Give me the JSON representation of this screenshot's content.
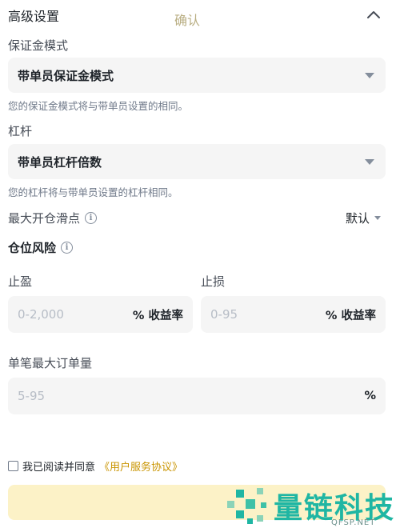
{
  "section": {
    "title": "高级设置",
    "collapse_icon": "chevron-up-icon"
  },
  "margin_mode": {
    "label": "保证金模式",
    "value": "带单员保证金模式",
    "hint": "您的保证金模式将与带单员设置的相同。"
  },
  "leverage": {
    "label": "杠杆",
    "value": "带单员杠杆倍数",
    "hint": "您的杠杆将与带单员设置的杠杆相同。"
  },
  "slippage": {
    "label": "最大开仓滑点",
    "value": "默认",
    "info_icon": "info-icon"
  },
  "position_risk": {
    "label": "仓位风险",
    "info_icon": "info-icon"
  },
  "take_profit": {
    "label": "止盈",
    "placeholder": "0-2,000",
    "suffix": "% 收益率"
  },
  "stop_loss": {
    "label": "止损",
    "placeholder": "0-95",
    "suffix": "% 收益率"
  },
  "max_order": {
    "label": "单笔最大订单量",
    "placeholder": "5-95",
    "suffix": "%"
  },
  "agreement": {
    "text": "我已阅读并同意",
    "link": "《用户服务协议》",
    "checked": false
  },
  "confirm": {
    "label": "确认"
  },
  "watermark": {
    "text": "量链科技",
    "url": "QFSP.NET"
  },
  "colors": {
    "accent": "#c99400",
    "confirm_bg": "#fcf2c7",
    "field_bg": "#f5f5f5",
    "watermark": "#1fb6a3"
  }
}
